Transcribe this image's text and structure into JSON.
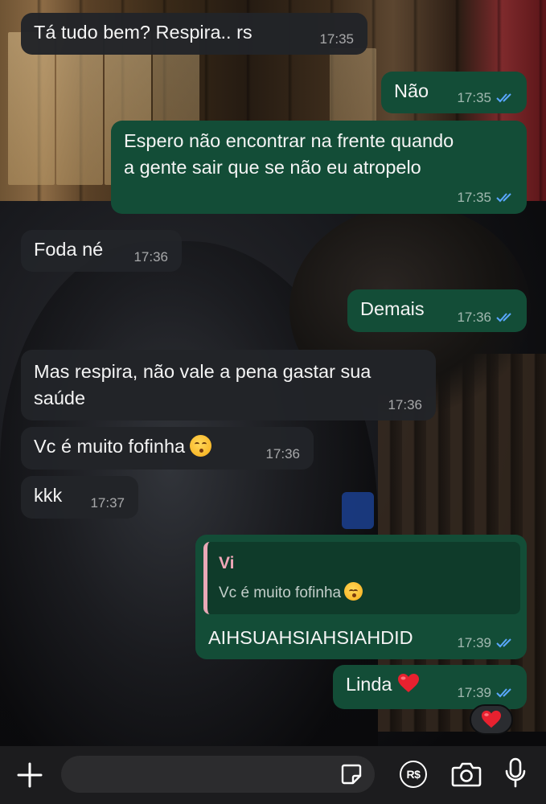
{
  "colors": {
    "incoming_bubble": "#222428",
    "outgoing_bubble": "#134d37",
    "read_ticks": "#5aa7ff",
    "quote_author": "#f0a7b8",
    "input_bar": "#1c1c1e"
  },
  "messages": [
    {
      "direction": "incoming",
      "text": "Tá tudo bem? Respira.. rs",
      "time": "17:35"
    },
    {
      "direction": "outgoing",
      "text": "Não",
      "time": "17:35",
      "status": "read"
    },
    {
      "direction": "outgoing",
      "text": "Espero não encontrar na frente quando\na gente sair que se não eu atropelo",
      "time": "17:35",
      "status": "read"
    },
    {
      "direction": "incoming",
      "text": "Foda né",
      "time": "17:36"
    },
    {
      "direction": "outgoing",
      "text": "Demais",
      "time": "17:36",
      "status": "read"
    },
    {
      "direction": "incoming",
      "text": "Mas respira, não vale a pena gastar sua\nsaúde",
      "time": "17:36"
    },
    {
      "direction": "incoming",
      "text": "Vc é muito fofinha",
      "emoji": "kissing-closed-eyes-emoji",
      "time": "17:36"
    },
    {
      "direction": "incoming",
      "text": "kkk",
      "time": "17:37"
    },
    {
      "direction": "outgoing",
      "quote": {
        "author": "Vi",
        "text": "Vc é muito fofinha",
        "emoji": "kissing-closed-eyes-emoji"
      },
      "text": "AIHSUAHSIAHSIAHDID",
      "time": "17:39",
      "status": "read"
    },
    {
      "direction": "outgoing",
      "text": "Linda",
      "emoji": "red-heart-emoji",
      "time": "17:39",
      "status": "read",
      "reaction": "red-heart-emoji"
    }
  ],
  "input_bar": {
    "left_icon": "plus-icon",
    "sticker_icon": "sticker-icon",
    "payment_icon": "payment-icon",
    "payment_label": "R$",
    "camera_icon": "camera-icon",
    "mic_icon": "microphone-icon"
  }
}
